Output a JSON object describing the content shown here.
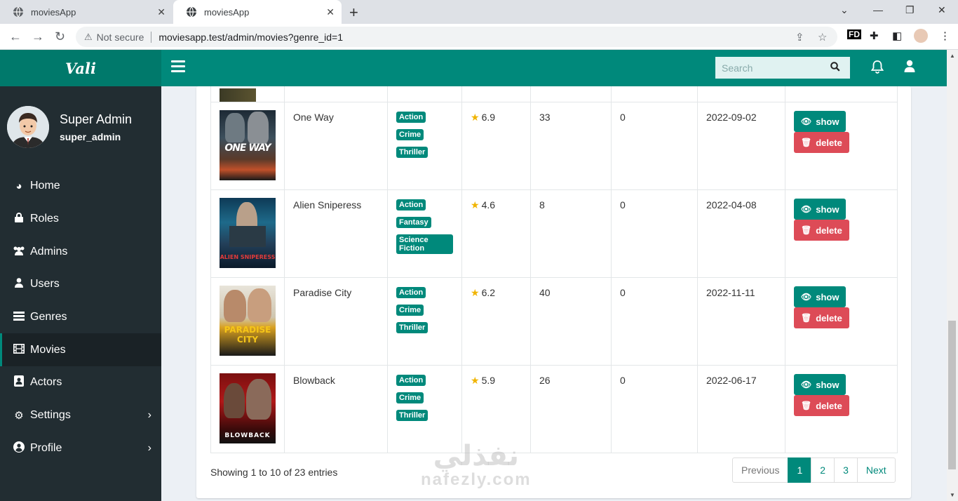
{
  "browser": {
    "tabs": [
      {
        "title": "moviesApp",
        "active": false
      },
      {
        "title": "moviesApp",
        "active": true
      }
    ],
    "security_label": "Not secure",
    "url": "moviesapp.test/admin/movies?genre_id=1"
  },
  "header": {
    "logo": "Vali",
    "search_placeholder": "Search"
  },
  "user": {
    "name": "Super Admin",
    "role": "super_admin"
  },
  "sidebar": {
    "items": [
      {
        "label": "Home",
        "icon": "dashboard-icon"
      },
      {
        "label": "Roles",
        "icon": "lock-icon"
      },
      {
        "label": "Admins",
        "icon": "users-icon"
      },
      {
        "label": "Users",
        "icon": "user-icon"
      },
      {
        "label": "Genres",
        "icon": "list-icon"
      },
      {
        "label": "Movies",
        "icon": "film-icon",
        "active": true
      },
      {
        "label": "Actors",
        "icon": "portrait-icon"
      },
      {
        "label": "Settings",
        "icon": "cogs-icon",
        "has_submenu": true
      },
      {
        "label": "Profile",
        "icon": "user-circle-icon",
        "has_submenu": true
      }
    ]
  },
  "movies": {
    "rows": [
      {
        "title": "One Way",
        "genres": [
          "Action",
          "Crime",
          "Thriller"
        ],
        "rating": "6.9",
        "count": "33",
        "favorites": "0",
        "release_date": "2022-09-02",
        "poster_text": "ONE WAY"
      },
      {
        "title": "Alien Sniperess",
        "genres": [
          "Action",
          "Fantasy",
          "Science Fiction"
        ],
        "rating": "4.6",
        "count": "8",
        "favorites": "0",
        "release_date": "2022-04-08",
        "poster_text": "ALIEN SNIPERESS"
      },
      {
        "title": "Paradise City",
        "genres": [
          "Action",
          "Crime",
          "Thriller"
        ],
        "rating": "6.2",
        "count": "40",
        "favorites": "0",
        "release_date": "2022-11-11",
        "poster_text": "PARADISE CITY"
      },
      {
        "title": "Blowback",
        "genres": [
          "Action",
          "Crime",
          "Thriller"
        ],
        "rating": "5.9",
        "count": "26",
        "favorites": "0",
        "release_date": "2022-06-17",
        "poster_text": "BLOWBACK"
      }
    ],
    "show_label": "show",
    "delete_label": "delete"
  },
  "table_info": "Showing 1 to 10 of 23 entries",
  "pagination": {
    "previous": "Previous",
    "pages": [
      "1",
      "2",
      "3"
    ],
    "current": "1",
    "next": "Next"
  },
  "watermark": {
    "arabic": "نفذلي",
    "latin": "nafezly.com"
  },
  "colors": {
    "primary": "#00897b",
    "sidebar": "#222d32",
    "danger": "#dd4b57",
    "star": "#f0b400"
  }
}
